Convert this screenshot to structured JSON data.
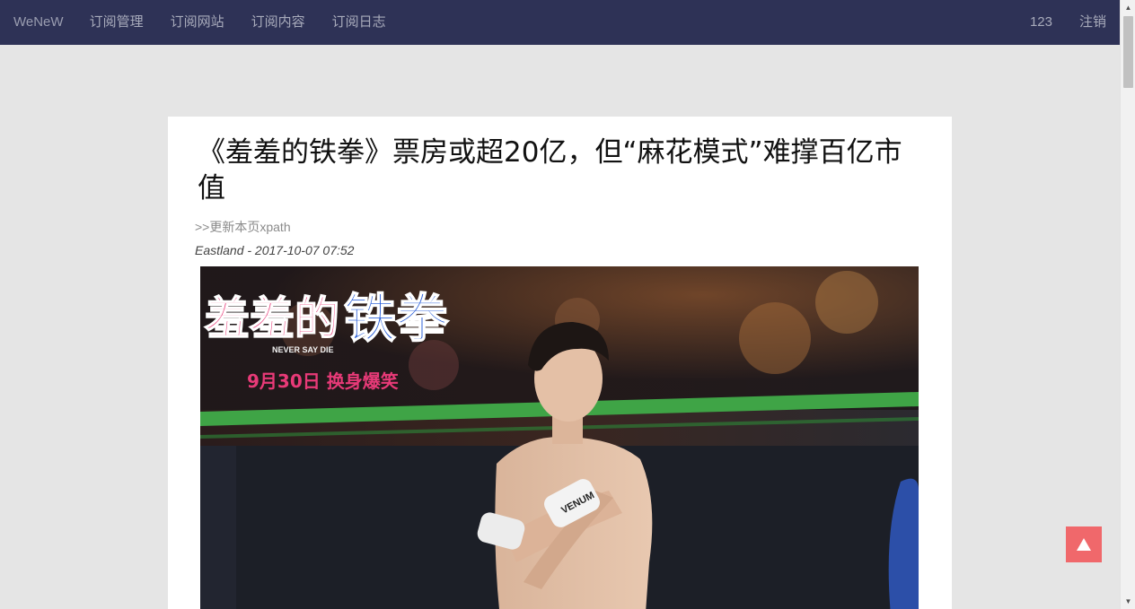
{
  "nav": {
    "brand": "WeNeW",
    "links": [
      "订阅管理",
      "订阅网站",
      "订阅内容",
      "订阅日志"
    ],
    "user": "123",
    "logout": "注销"
  },
  "article": {
    "title": "《羞羞的铁拳》票房或超20亿，但“麻花模式”难撑百亿市值",
    "xpath_link": ">>更新本页xpath",
    "meta": "Eastland - 2017-10-07 07:52"
  },
  "poster": {
    "title_part1": "羞羞的",
    "title_part2": "铁拳",
    "subtitle": "NEVER SAY DIE",
    "release": "9月30日 换身爆笑",
    "glove_text": "VENUM"
  },
  "colors": {
    "navbar": "#2e3256",
    "background": "#e5e5e5",
    "back_to_top": "#f0686b",
    "poster_pink": "#e83a78",
    "poster_blue": "#2b5fd8"
  },
  "icons": {
    "back_to_top": "triangle-up-icon",
    "scroll_up": "triangle-up-icon",
    "scroll_down": "triangle-down-icon"
  }
}
